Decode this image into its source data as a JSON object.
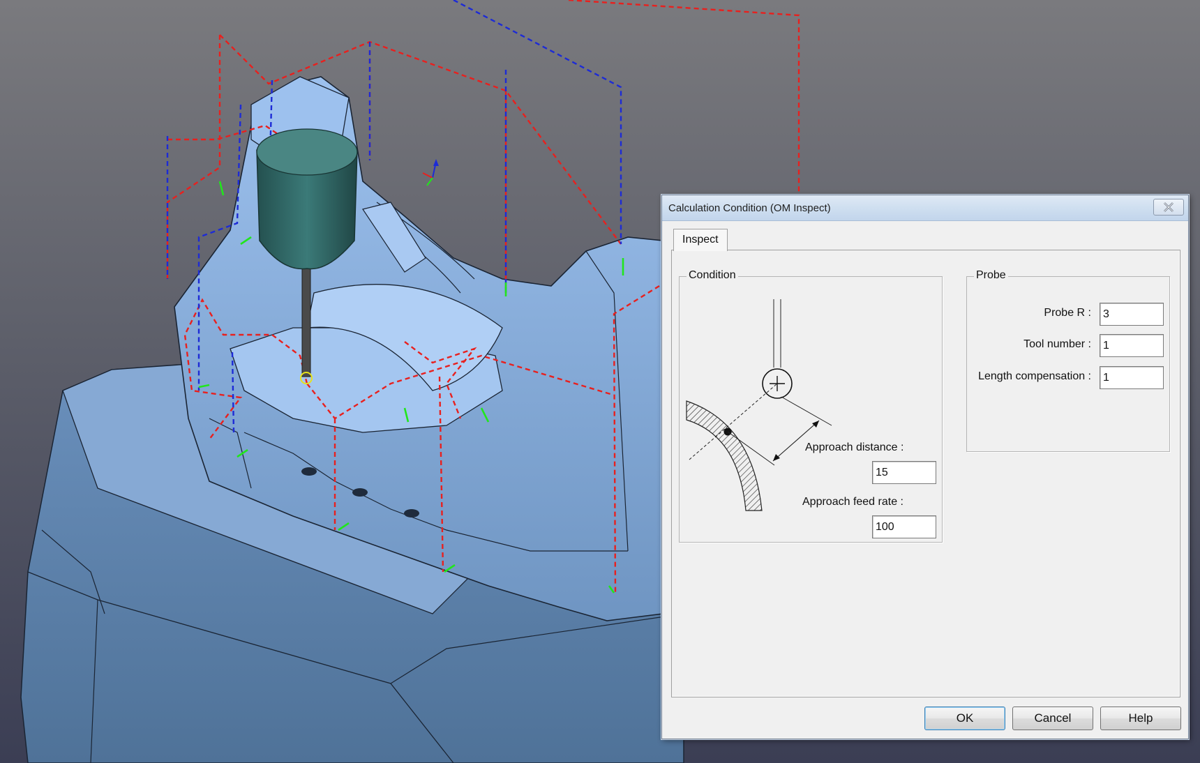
{
  "viewport": {
    "colors": {
      "background_top": "#7a7a7e",
      "background_bottom": "#3b3e54",
      "part_surface": "#8fb5e6",
      "part_shadow": "#5b80a8",
      "probe_body": "#2f6463",
      "toolpath_rapid": "#e8201e",
      "toolpath_approach": "#1d2bd6",
      "contact_vector": "#21e61c"
    }
  },
  "dialog": {
    "title": "Calculation Condition (OM Inspect)",
    "close_icon": "close-icon",
    "tabs": [
      {
        "label": "Inspect",
        "active": true
      }
    ],
    "condition": {
      "group_label": "Condition",
      "approach_distance": {
        "label": "Approach distance :",
        "value": "15"
      },
      "approach_feed_rate": {
        "label": "Approach feed rate :",
        "value": "100"
      }
    },
    "probe": {
      "group_label": "Probe",
      "probe_r": {
        "label": "Probe R :",
        "value": "3"
      },
      "tool_number": {
        "label": "Tool number :",
        "value": "1"
      },
      "length_compensation": {
        "label": "Length compensation :",
        "value": "1"
      }
    },
    "buttons": {
      "ok": "OK",
      "cancel": "Cancel",
      "help": "Help"
    }
  }
}
